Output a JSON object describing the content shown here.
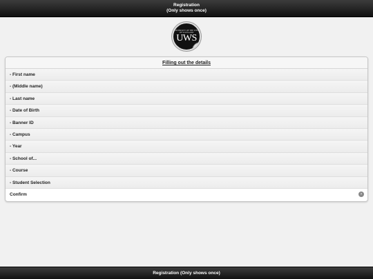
{
  "header": {
    "title_line1": "Registration",
    "title_line2": "(Only shows once)"
  },
  "logo": {
    "small_text": "UNIVERSITY OF THE WEST OF SCOTLAND",
    "big_text": "UWS"
  },
  "form": {
    "title": "Filling out the details",
    "fields": [
      {
        "label": "- First name"
      },
      {
        "label": "- (Middle name)"
      },
      {
        "label": "- Last name"
      },
      {
        "label": "- Date of Birth"
      },
      {
        "label": "- Banner ID"
      },
      {
        "label": "- Campus"
      },
      {
        "label": "- Year"
      },
      {
        "label": "- School of..."
      },
      {
        "label": "- Course"
      },
      {
        "label": "- Student Selection"
      }
    ],
    "confirm_label": "Confirm",
    "confirm_icon": "chevron-right-icon"
  },
  "footer": {
    "title": "Registration (Only shows once)"
  },
  "colors": {
    "bar": "#1a1a1a",
    "background": "#f1f1f1"
  }
}
